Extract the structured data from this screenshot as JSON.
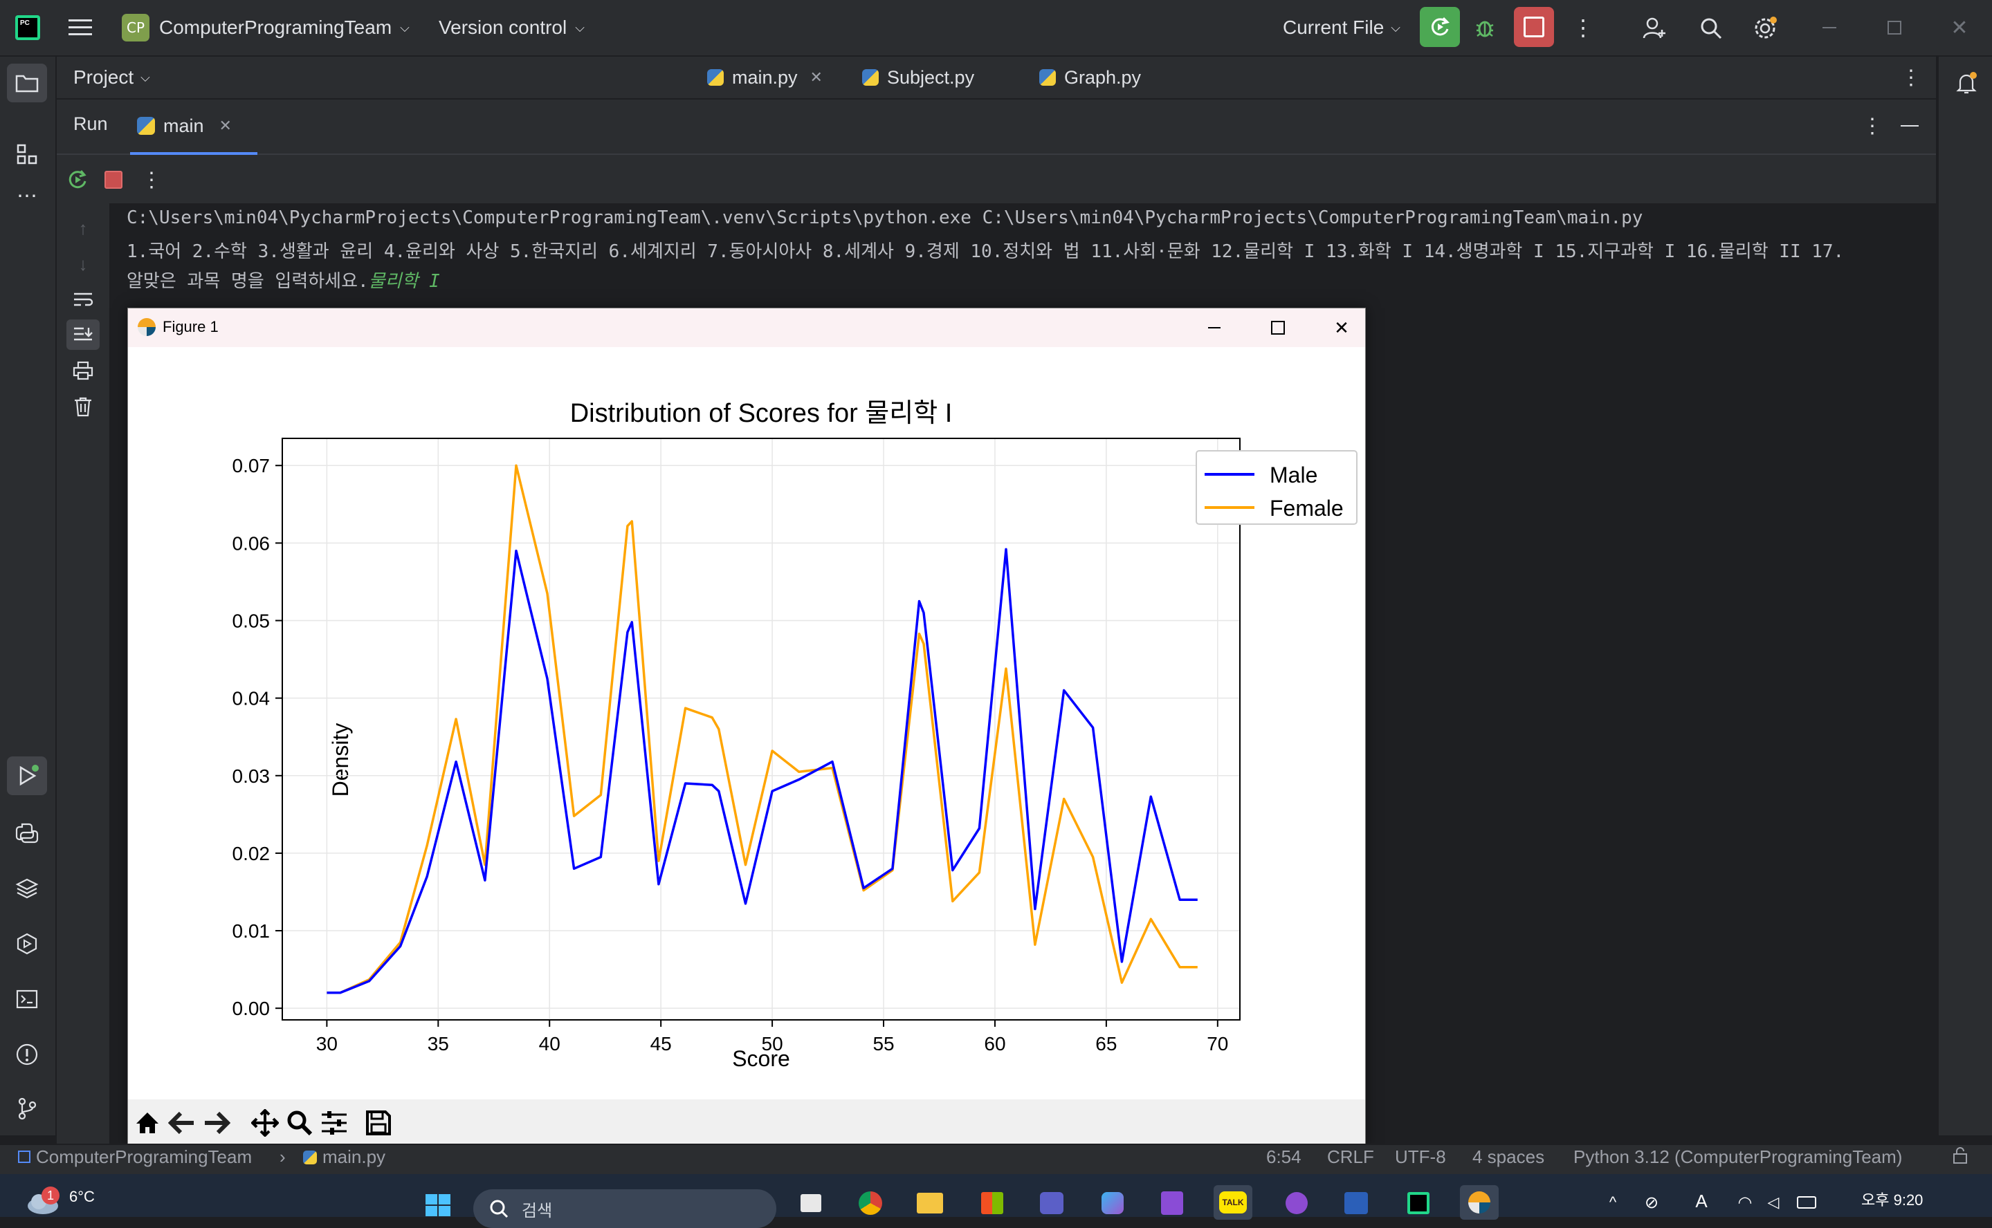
{
  "titlebar": {
    "project_badge": "CP",
    "project_name": "ComputerProgramingTeam",
    "vcs": "Version control",
    "run_config": "Current File"
  },
  "sidebar_top": {
    "project_label": "Project"
  },
  "editor_tabs": [
    {
      "label": "main.py"
    },
    {
      "label": "Subject.py"
    },
    {
      "label": "Graph.py"
    }
  ],
  "run_panel": {
    "title": "Run",
    "tab_label": "main"
  },
  "console": {
    "line1": "C:\\Users\\min04\\PycharmProjects\\ComputerProgramingTeam\\.venv\\Scripts\\python.exe C:\\Users\\min04\\PycharmProjects\\ComputerProgramingTeam\\main.py",
    "line2": "1.국어 2.수학 3.생활과 윤리 4.윤리와 사상 5.한국지리 6.세계지리 7.동아시아사 8.세계사 9.경제 10.정치와 법 11.사회·문화 12.물리학 I 13.화학 I 14.생명과학 I 15.지구과학 I 16.물리학 II 17.",
    "line3_prompt": "알맞은 과목 명을 입력하세요.",
    "line3_input": "물리학 I"
  },
  "figure_window": {
    "title": "Figure 1"
  },
  "chart_data": {
    "type": "line",
    "title": "Distribution of Scores for 물리학 I",
    "xlabel": "Score",
    "ylabel": "Density",
    "xlim": [
      28,
      71
    ],
    "ylim": [
      -0.0015,
      0.0735
    ],
    "xticks": [
      30,
      35,
      40,
      45,
      50,
      55,
      60,
      65,
      70
    ],
    "yticks": [
      0.0,
      0.01,
      0.02,
      0.03,
      0.04,
      0.05,
      0.06,
      0.07
    ],
    "ytick_labels": [
      "0.00",
      "0.01",
      "0.02",
      "0.03",
      "0.04",
      "0.05",
      "0.06",
      "0.07"
    ],
    "grid": true,
    "legend": "top-right",
    "series": [
      {
        "name": "Male",
        "color": "#0000ff",
        "x": [
          30,
          30.6,
          31.9,
          33.3,
          34.5,
          35.8,
          37.1,
          38.5,
          39.9,
          41.1,
          42.3,
          43.5,
          43.7,
          44.9,
          46.1,
          47.3,
          47.6,
          48.8,
          50.0,
          51.2,
          52.7,
          54.1,
          55.4,
          56.6,
          56.8,
          58.1,
          59.3,
          60.5,
          61.8,
          63.1,
          64.4,
          65.7,
          67.0,
          68.3,
          69.1
        ],
        "y": [
          0.002,
          0.002,
          0.0035,
          0.008,
          0.017,
          0.0318,
          0.0165,
          0.059,
          0.0425,
          0.018,
          0.0195,
          0.0485,
          0.0498,
          0.016,
          0.029,
          0.0288,
          0.028,
          0.0135,
          0.028,
          0.0295,
          0.0318,
          0.0155,
          0.018,
          0.0525,
          0.051,
          0.0178,
          0.0232,
          0.0592,
          0.0128,
          0.041,
          0.0362,
          0.006,
          0.0273,
          0.014,
          0.014
        ]
      },
      {
        "name": "Female",
        "color": "#ffa500",
        "x": [
          30,
          30.6,
          31.9,
          33.3,
          34.5,
          35.8,
          37.1,
          38.5,
          39.9,
          41.1,
          42.3,
          43.5,
          43.7,
          44.9,
          46.1,
          47.3,
          47.6,
          48.8,
          50.0,
          51.2,
          52.7,
          54.1,
          55.4,
          56.6,
          56.8,
          58.1,
          59.3,
          60.5,
          61.8,
          63.1,
          64.4,
          65.7,
          67.0,
          68.3,
          69.1
        ],
        "y": [
          0.002,
          0.002,
          0.0037,
          0.0085,
          0.021,
          0.0373,
          0.0185,
          0.07,
          0.0535,
          0.0248,
          0.0275,
          0.0622,
          0.0628,
          0.019,
          0.0387,
          0.0375,
          0.036,
          0.0185,
          0.0332,
          0.0305,
          0.031,
          0.0152,
          0.0178,
          0.0483,
          0.047,
          0.0138,
          0.0175,
          0.0438,
          0.0082,
          0.027,
          0.0195,
          0.0033,
          0.0115,
          0.0053,
          0.0053
        ]
      }
    ]
  },
  "statusbar": {
    "project": "ComputerProgramingTeam",
    "file": "main.py",
    "position": "6:54",
    "line_sep": "CRLF",
    "encoding": "UTF-8",
    "indent": "4 spaces",
    "interpreter": "Python 3.12 (ComputerProgramingTeam)"
  },
  "taskbar": {
    "weather_badge": "1",
    "temperature": "6°C",
    "search_placeholder": "검색",
    "kakao_label": "TALK",
    "clock_time": "오후 9:20"
  },
  "colors": {
    "ide_bg": "#1e1f22",
    "panel_bg": "#2b2d30",
    "run_green": "#4ca853",
    "stop_red": "#c94f4f",
    "male": "#0000ff",
    "female": "#ffa500"
  }
}
